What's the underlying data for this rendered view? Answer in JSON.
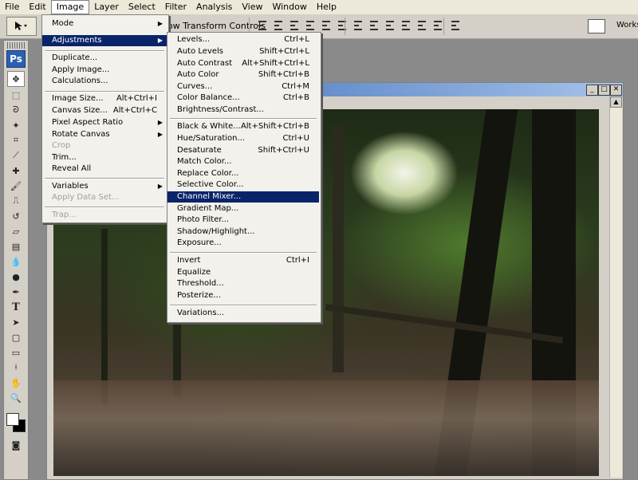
{
  "menubar": [
    "File",
    "Edit",
    "Image",
    "Layer",
    "Select",
    "Filter",
    "Analysis",
    "View",
    "Window",
    "Help"
  ],
  "optionsbar": {
    "transform_label": "ow Transform Controls",
    "workspace_label": "Works"
  },
  "toolbox": {
    "logo": "Ps",
    "tools": [
      "move-icon",
      "marquee-icon",
      "lasso-icon",
      "magic-wand-icon",
      "crop-icon",
      "slice-icon",
      "healing-icon",
      "brush-icon",
      "stamp-icon",
      "history-brush-icon",
      "eraser-icon",
      "gradient-icon",
      "blur-icon",
      "dodge-icon",
      "pen-icon",
      "type-icon",
      "path-select-icon",
      "shape-icon",
      "notes-icon",
      "eyedropper-icon",
      "hand-icon",
      "zoom-icon"
    ]
  },
  "image_menu": {
    "items": [
      {
        "label": "Mode",
        "submenu": true
      },
      {
        "label": "Adjustments",
        "submenu": true,
        "highlighted": true
      },
      {
        "label": "Duplicate..."
      },
      {
        "label": "Apply Image..."
      },
      {
        "label": "Calculations..."
      },
      {
        "label": "Image Size...",
        "shortcut": "Alt+Ctrl+I"
      },
      {
        "label": "Canvas Size...",
        "shortcut": "Alt+Ctrl+C"
      },
      {
        "label": "Pixel Aspect Ratio",
        "submenu": true
      },
      {
        "label": "Rotate Canvas",
        "submenu": true
      },
      {
        "label": "Crop",
        "disabled": true
      },
      {
        "label": "Trim..."
      },
      {
        "label": "Reveal All"
      },
      {
        "label": "Variables",
        "submenu": true
      },
      {
        "label": "Apply Data Set...",
        "disabled": true
      },
      {
        "label": "Trap...",
        "disabled": true
      }
    ]
  },
  "adjustments_menu": {
    "items": [
      {
        "label": "Levels...",
        "shortcut": "Ctrl+L"
      },
      {
        "label": "Auto Levels",
        "shortcut": "Shift+Ctrl+L"
      },
      {
        "label": "Auto Contrast",
        "shortcut": "Alt+Shift+Ctrl+L"
      },
      {
        "label": "Auto Color",
        "shortcut": "Shift+Ctrl+B"
      },
      {
        "label": "Curves...",
        "shortcut": "Ctrl+M"
      },
      {
        "label": "Color Balance...",
        "shortcut": "Ctrl+B"
      },
      {
        "label": "Brightness/Contrast..."
      },
      {
        "label": "Black & White...",
        "shortcut": "Alt+Shift+Ctrl+B"
      },
      {
        "label": "Hue/Saturation...",
        "shortcut": "Ctrl+U"
      },
      {
        "label": "Desaturate",
        "shortcut": "Shift+Ctrl+U"
      },
      {
        "label": "Match Color..."
      },
      {
        "label": "Replace Color..."
      },
      {
        "label": "Selective Color..."
      },
      {
        "label": "Channel Mixer...",
        "highlighted": true
      },
      {
        "label": "Gradient Map..."
      },
      {
        "label": "Photo Filter..."
      },
      {
        "label": "Shadow/Highlight..."
      },
      {
        "label": "Exposure..."
      },
      {
        "label": "Invert",
        "shortcut": "Ctrl+I"
      },
      {
        "label": "Equalize"
      },
      {
        "label": "Threshold..."
      },
      {
        "label": "Posterize..."
      },
      {
        "label": "Variations..."
      }
    ]
  },
  "colors": {
    "menu_highlight": "#0a246a",
    "title_bar": "#2a5fb0"
  }
}
